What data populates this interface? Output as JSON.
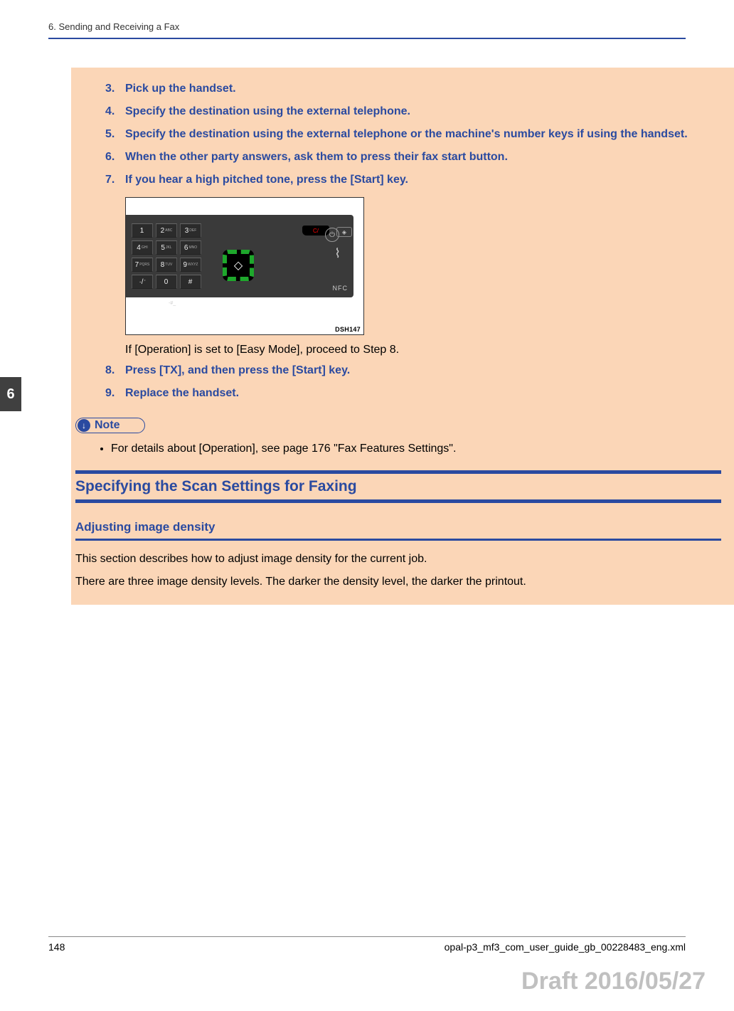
{
  "header": {
    "chapter_title": "6. Sending and Receiving a Fax"
  },
  "steps": [
    {
      "num": "3.",
      "text": "Pick up the handset."
    },
    {
      "num": "4.",
      "text": "Specify the destination using the external telephone."
    },
    {
      "num": "5.",
      "text": "Specify the destination using the external telephone or the machine's number keys if using the handset."
    },
    {
      "num": "6.",
      "text": "When the other party answers, ask them to press their fax start button."
    },
    {
      "num": "7.",
      "text": "If you hear a high pitched tone, press the [Start] key."
    }
  ],
  "figure": {
    "keys": {
      "r1": [
        {
          "n": "1",
          "l": ""
        },
        {
          "n": "2",
          "l": "ABC"
        },
        {
          "n": "3",
          "l": "DEF"
        }
      ],
      "r2": [
        {
          "n": "4",
          "l": "GHI"
        },
        {
          "n": "5",
          "l": "JKL"
        },
        {
          "n": "6",
          "l": "MNO"
        }
      ],
      "r3": [
        {
          "n": "7",
          "l": "PQRS"
        },
        {
          "n": "8",
          "l": "TUV"
        },
        {
          "n": "9",
          "l": "WXYZ"
        }
      ],
      "r4": [
        {
          "n": "·/",
          "l": "*"
        },
        {
          "n": "0",
          "l": ""
        },
        {
          "n": "#",
          "l": ""
        }
      ]
    },
    "clear": "C/",
    "start": "◇",
    "nfc": "NFC",
    "lang": "◈",
    "power": "⏻",
    "dash_label": "DSH147",
    "dash_under": "-#_"
  },
  "step7_sub": "If [Operation] is set to [Easy Mode], proceed to Step 8.",
  "steps_b": [
    {
      "num": "8.",
      "text": "Press [TX], and then press the [Start] key."
    },
    {
      "num": "9.",
      "text": "Replace the handset."
    }
  ],
  "note": {
    "label": "Note",
    "items": [
      "For details about [Operation], see page 176 \"Fax Features Settings\"."
    ]
  },
  "section_heading": "Specifying the Scan Settings for Faxing",
  "sub_heading": "Adjusting image density",
  "body": [
    "This section describes how to adjust image density for the current job.",
    "There are three image density levels. The darker the density level, the darker the printout."
  ],
  "thumb_tab": "6",
  "footer": {
    "page_num": "148",
    "source": "opal-p3_mf3_com_user_guide_gb_00228483_eng.xml"
  },
  "draft": "Draft 2016/05/27"
}
